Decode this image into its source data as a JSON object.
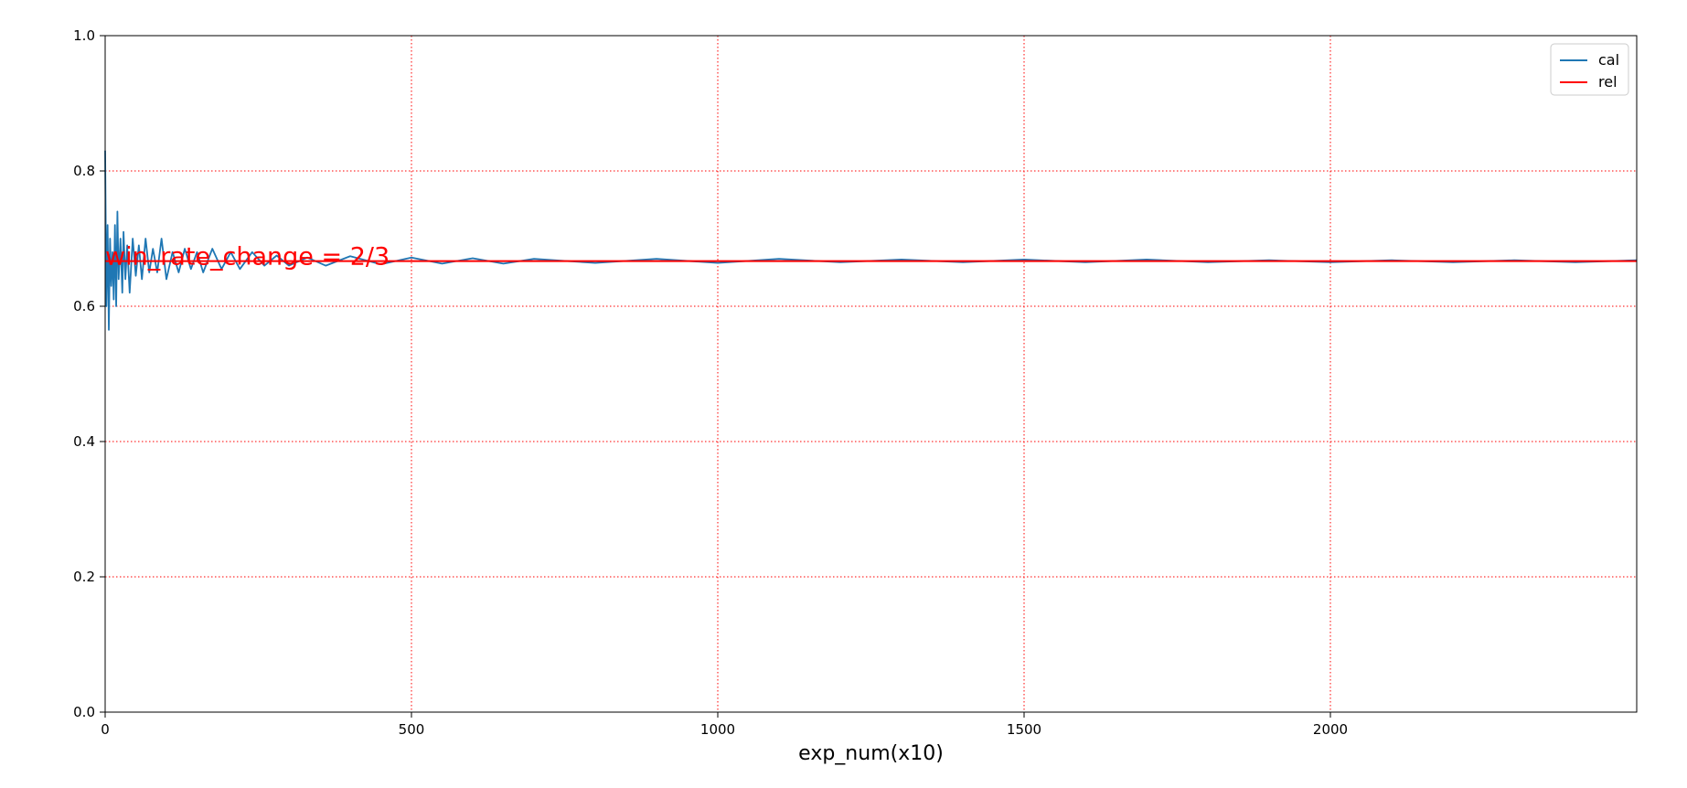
{
  "chart_data": {
    "type": "line",
    "title": "",
    "xlabel": "exp_num(x10)",
    "ylabel": "",
    "xlim": [
      0,
      2500
    ],
    "ylim": [
      0.0,
      1.0
    ],
    "x_ticks": [
      0,
      500,
      1000,
      1500,
      2000
    ],
    "x_tick_labels": [
      "0",
      "500",
      "1000",
      "1500",
      "2000"
    ],
    "y_ticks": [
      0.0,
      0.2,
      0.4,
      0.6,
      0.8,
      1.0
    ],
    "y_tick_labels": [
      "0.0",
      "0.2",
      "0.4",
      "0.6",
      "0.8",
      "1.0"
    ],
    "grid": true,
    "grid_color": "#ff0000",
    "legend_position": "top-right",
    "annotation": {
      "text": "win_rate_change = 2/3",
      "x": 0,
      "y": 0.6667,
      "color": "#ff0000"
    },
    "series": [
      {
        "name": "cal",
        "color": "#1f77b4",
        "x": [
          0,
          2,
          4,
          6,
          8,
          10,
          12,
          14,
          16,
          18,
          20,
          22,
          25,
          28,
          30,
          33,
          36,
          40,
          45,
          50,
          55,
          60,
          66,
          72,
          78,
          85,
          92,
          100,
          110,
          120,
          130,
          140,
          150,
          160,
          175,
          190,
          205,
          220,
          240,
          260,
          280,
          300,
          330,
          360,
          400,
          450,
          500,
          550,
          600,
          650,
          700,
          800,
          900,
          1000,
          1100,
          1200,
          1300,
          1400,
          1500,
          1600,
          1700,
          1800,
          1900,
          2000,
          2100,
          2200,
          2300,
          2400,
          2500
        ],
        "values": [
          0.83,
          0.6,
          0.72,
          0.565,
          0.7,
          0.63,
          0.68,
          0.61,
          0.72,
          0.6,
          0.74,
          0.64,
          0.7,
          0.62,
          0.71,
          0.64,
          0.69,
          0.62,
          0.7,
          0.645,
          0.69,
          0.64,
          0.7,
          0.65,
          0.685,
          0.65,
          0.7,
          0.64,
          0.68,
          0.65,
          0.685,
          0.655,
          0.68,
          0.65,
          0.685,
          0.655,
          0.68,
          0.655,
          0.68,
          0.66,
          0.675,
          0.66,
          0.672,
          0.66,
          0.674,
          0.662,
          0.672,
          0.663,
          0.671,
          0.663,
          0.67,
          0.664,
          0.67,
          0.664,
          0.67,
          0.665,
          0.669,
          0.665,
          0.669,
          0.665,
          0.669,
          0.665,
          0.668,
          0.665,
          0.668,
          0.665,
          0.668,
          0.665,
          0.668
        ]
      },
      {
        "name": "rel",
        "color": "#ff0000",
        "x": [
          0,
          2500
        ],
        "values": [
          0.6667,
          0.6667
        ]
      }
    ]
  }
}
